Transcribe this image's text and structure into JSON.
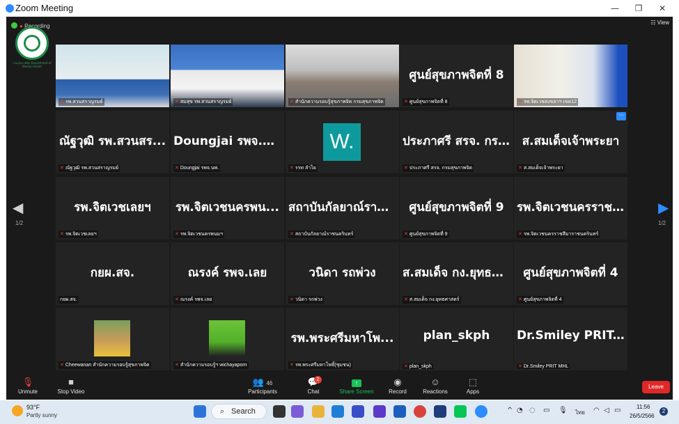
{
  "window": {
    "title": "Zoom Meeting"
  },
  "topbar": {
    "recording": "Recording",
    "view": "View"
  },
  "org_caption": "กรมสุขภาพจิต Department of Mental Health",
  "pagination": {
    "left": "1/2",
    "right": "1/2"
  },
  "tiles": [
    {
      "big": "",
      "label": "รพ.สวนสราญรมย์",
      "muted": true,
      "kind": "video1"
    },
    {
      "big": "",
      "label": "สมสุข รพ.สวนสราญรมย์",
      "muted": true,
      "kind": "video2"
    },
    {
      "big": "",
      "label": "สำนักความรอบรู้สุขภาพจิต กรมสุขภาพจิต",
      "muted": true,
      "kind": "video3"
    },
    {
      "big": "ศูนย์สุขภาพจิตที่ 8",
      "label": "ศูนย์สุขภาพจิตที่ 8",
      "muted": true,
      "kind": "text"
    },
    {
      "big": "",
      "label": "รพ.จิตเวชสงขลาฯ เขต12",
      "muted": true,
      "kind": "video4"
    },
    {
      "big": "ณัฐวุฒิ รพ.สวนสร...",
      "label": "ณัฐวุฒิ รพ.สวนสราญรมย์",
      "muted": true,
      "kind": "text"
    },
    {
      "big": "Doungjai รพจ.นพ.",
      "label": "Doungjai รพจ.นพ.",
      "muted": true,
      "kind": "text"
    },
    {
      "big": "W.",
      "label": "รรท ลำไย",
      "muted": true,
      "kind": "avatar"
    },
    {
      "big": "ประภาศรี สรจ. กร...",
      "label": "ประภาศรี สรจ. กรมสุขภาพจิต",
      "muted": true,
      "kind": "text"
    },
    {
      "big": "ส.สมเด็จเจ้าพระยา",
      "label": "ส.สมเด็จเจ้าพระยา",
      "muted": true,
      "kind": "text",
      "more": "···"
    },
    {
      "big": "รพ.จิตเวชเลยฯ",
      "label": "รพ.จิตเวชเลยฯ",
      "muted": true,
      "kind": "text"
    },
    {
      "big": "รพ.จิตเวชนครพน...",
      "label": "รพ.จิตเวชนครพนมฯ",
      "muted": true,
      "kind": "text"
    },
    {
      "big": "สถาบันกัลยาณ์ราช...",
      "label": "สถาบันกัลยาณ์ราชนครินทร์",
      "muted": true,
      "kind": "text"
    },
    {
      "big": "ศูนย์สุขภาพจิตที่ 9",
      "label": "ศูนย์สุขภาพจิตที่ 9",
      "muted": true,
      "kind": "text"
    },
    {
      "big": "รพ.จิตเวชนครราช...",
      "label": "รพ.จิตเวชนครราชสีมาราชนครินทร์",
      "muted": true,
      "kind": "text"
    },
    {
      "big": "กยผ.สจ.",
      "label": "กยผ.สจ.",
      "muted": false,
      "kind": "text"
    },
    {
      "big": "ณรงค์ รพจ.เลย",
      "label": "ณรงค์ รพจ.เลย",
      "muted": true,
      "kind": "text"
    },
    {
      "big": "วนิดา รถพ่วง",
      "label": "วนิดา รถพ่วง",
      "muted": true,
      "kind": "text"
    },
    {
      "big": "ส.สมเด็จ กง.ยุทธศ...",
      "label": "ส.สมเด็จ กง.ยุทธศาสตร์",
      "muted": true,
      "kind": "text"
    },
    {
      "big": "ศูนย์สุขภาพจิตที่ 4",
      "label": "ศูนย์สุขภาพจิตที่ 4",
      "muted": true,
      "kind": "text"
    },
    {
      "big": "",
      "label": "Cheewanan สำนักความรอบรู้สุขภาพจิต",
      "muted": true,
      "kind": "thumb1"
    },
    {
      "big": "",
      "label": "สำนักความรอบรู้ฯ wichayaporn",
      "muted": true,
      "kind": "thumb2"
    },
    {
      "big": "รพ.พระศรีมหาโพ...",
      "label": "รพ.พระศรีมหาโพธิ์(ชุมชน)",
      "muted": true,
      "kind": "text"
    },
    {
      "big": "plan_skph",
      "label": "plan_skph",
      "muted": true,
      "kind": "text"
    },
    {
      "big": "Dr.Smiley PRIT...",
      "label": "Dr.Smiley PRIT MHL",
      "muted": true,
      "kind": "text"
    }
  ],
  "toolbar": {
    "unmute": "Unmute",
    "stop_video": "Stop Video",
    "participants": "Participants",
    "participants_count": "46",
    "chat": "Chat",
    "chat_badge": "2",
    "share_screen": "Share Screen",
    "record": "Record",
    "reactions": "Reactions",
    "apps": "Apps",
    "leave": "Leave"
  },
  "taskbar": {
    "temp": "93°F",
    "weather": "Partly sunny",
    "search": "Search",
    "time": "11:56",
    "date": "26/5/2566",
    "lang": "ไทย",
    "notif": "2"
  },
  "colors": {
    "zoom_blue": "#2d8cff",
    "leave_red": "#e02828",
    "active_speaker": "#e5e838",
    "share_green": "#1bbf5a"
  }
}
